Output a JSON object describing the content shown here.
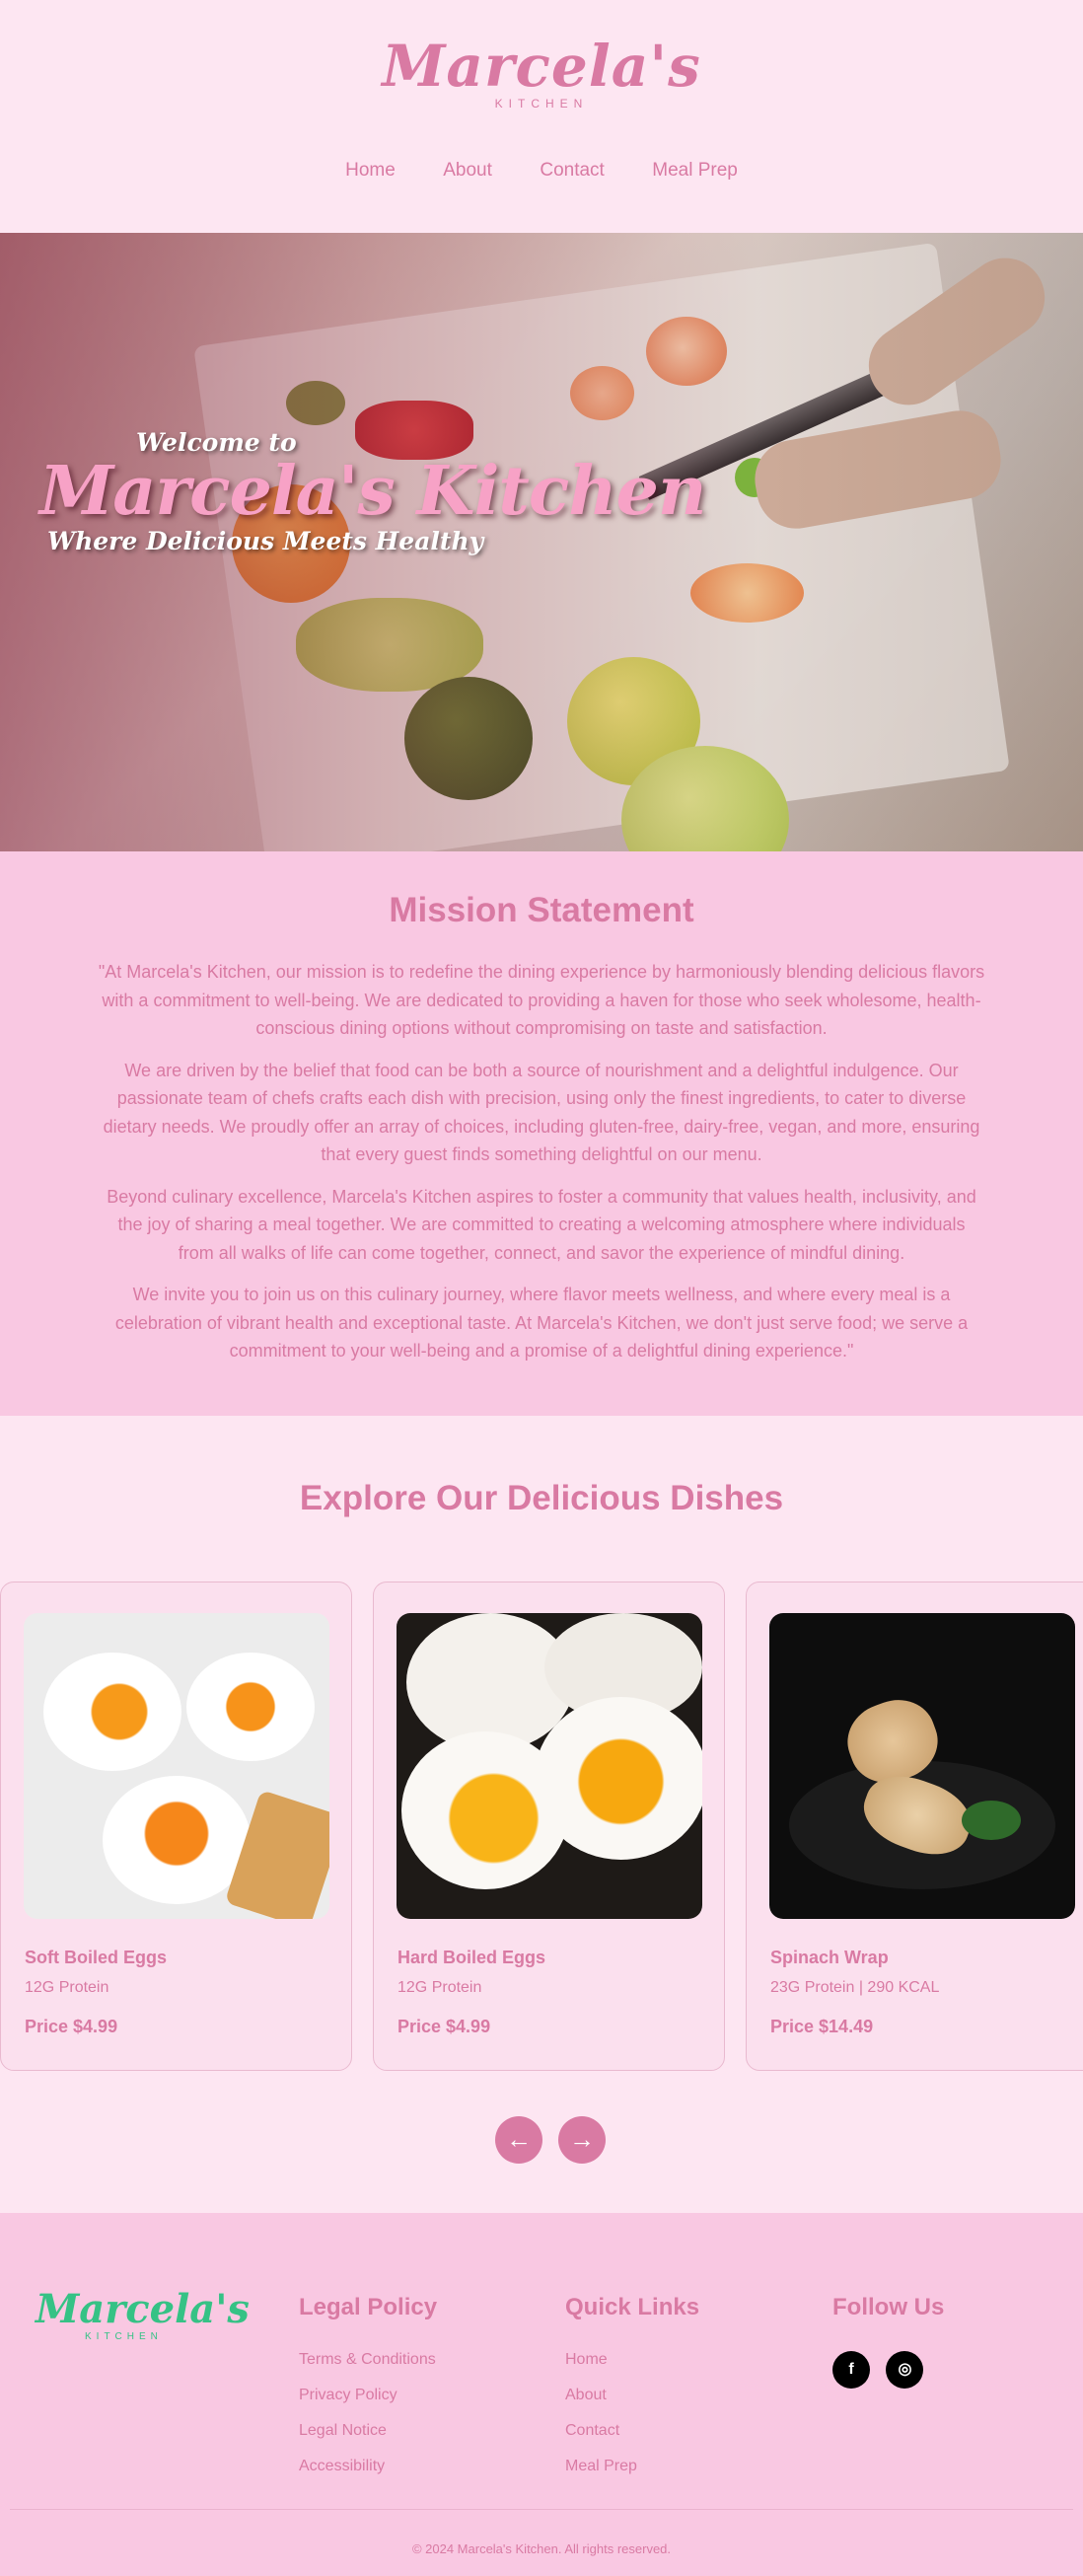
{
  "brand": {
    "name": "Marcela's",
    "sub": "KITCHEN"
  },
  "nav": [
    {
      "label": "Home"
    },
    {
      "label": "About"
    },
    {
      "label": "Contact"
    },
    {
      "label": "Meal Prep"
    }
  ],
  "hero": {
    "welcome": "Welcome to",
    "title": "Marcela's Kitchen",
    "tagline": "Where Delicious Meets Healthy"
  },
  "mission": {
    "heading": "Mission Statement",
    "paragraphs": [
      "\"At Marcela's Kitchen, our mission is to redefine the dining experience by harmoniously blending delicious flavors with a commitment to well-being. We are dedicated to providing a haven for those who seek wholesome, health-conscious dining options without compromising on taste and satisfaction.",
      "We are driven by the belief that food can be both a source of nourishment and a delightful indulgence. Our passionate team of chefs crafts each dish with precision, using only the finest ingredients, to cater to diverse dietary needs. We proudly offer an array of choices, including gluten-free, dairy-free, vegan, and more, ensuring that every guest finds something delightful on our menu.",
      "Beyond culinary excellence, Marcela's Kitchen aspires to foster a community that values health, inclusivity, and the joy of sharing a meal together. We are committed to creating a welcoming atmosphere where individuals from all walks of life can come together, connect, and savor the experience of mindful dining.",
      "We invite you to join us on this culinary journey, where flavor meets wellness, and where every meal is a celebration of vibrant health and exceptional taste. At Marcela's Kitchen, we don't just serve food; we serve a commitment to your well-being and a promise of a delightful dining experience.\""
    ]
  },
  "dishes": {
    "heading": "Explore Our Delicious Dishes",
    "items": [
      {
        "name": "Soft Boiled Eggs",
        "meta": "12G Protein",
        "price": "Price $4.99"
      },
      {
        "name": "Hard Boiled Eggs",
        "meta": "12G Protein",
        "price": "Price $4.99"
      },
      {
        "name": "Spinach Wrap",
        "meta": "23G Protein | 290 KCAL",
        "price": "Price $14.49"
      }
    ],
    "prev_icon": "←",
    "next_icon": "→"
  },
  "footer": {
    "logo": {
      "name": "Marcela's",
      "sub": "KITCHEN"
    },
    "legal": {
      "heading": "Legal Policy",
      "links": [
        "Terms & Conditions",
        "Privacy Policy",
        "Legal Notice",
        "Accessibility"
      ]
    },
    "quick": {
      "heading": "Quick Links",
      "links": [
        "Home",
        "About",
        "Contact",
        "Meal Prep"
      ]
    },
    "follow": {
      "heading": "Follow Us",
      "facebook_icon": "f",
      "instagram_icon": "◎"
    },
    "copyright": "© 2024 Marcela's Kitchen. All rights reserved."
  },
  "colors": {
    "accent_pink": "#d97aa3",
    "page_bg": "#fde6f2",
    "section_bg": "#f9c8e2",
    "footer_logo_green": "#35c285"
  }
}
